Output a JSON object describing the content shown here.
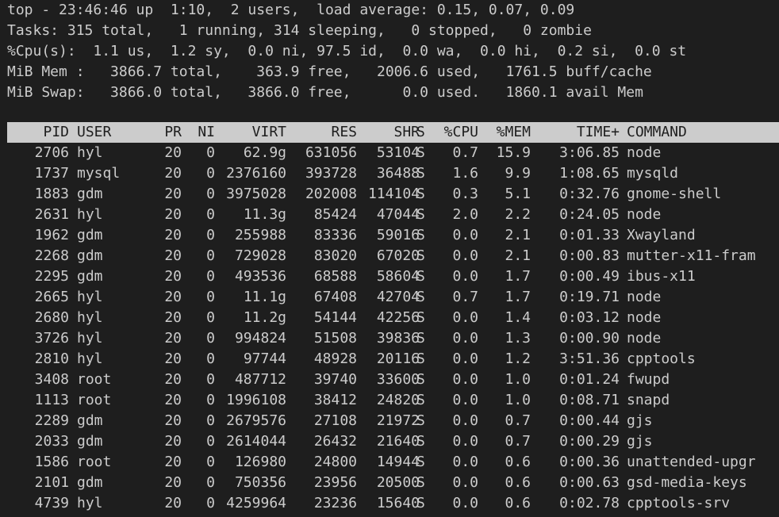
{
  "summary": {
    "line1": "top - 23:46:46 up  1:10,  2 users,  load average: 0.15, 0.07, 0.09",
    "line2": "Tasks: 315 total,   1 running, 314 sleeping,   0 stopped,   0 zombie",
    "line3": "%Cpu(s):  1.1 us,  1.2 sy,  0.0 ni, 97.5 id,  0.0 wa,  0.0 hi,  0.2 si,  0.0 st",
    "line4": "MiB Mem :   3866.7 total,    363.9 free,   2006.6 used,   1761.5 buff/cache",
    "line5": "MiB Swap:   3866.0 total,   3866.0 free,      0.0 used.   1860.1 avail Mem"
  },
  "columns": {
    "pid": "PID",
    "user": "USER",
    "pr": "PR",
    "ni": "NI",
    "virt": "VIRT",
    "res": "RES",
    "shr": "SHR",
    "s": "S",
    "cpu": "%CPU",
    "mem": "%MEM",
    "time": "TIME+",
    "command": "COMMAND"
  },
  "processes": [
    {
      "pid": "2706",
      "user": "hyl",
      "pr": "20",
      "ni": "0",
      "virt": "62.9g",
      "res": "631056",
      "shr": "53104",
      "s": "S",
      "cpu": "0.7",
      "mem": "15.9",
      "time": "3:06.85",
      "command": "node"
    },
    {
      "pid": "1737",
      "user": "mysql",
      "pr": "20",
      "ni": "0",
      "virt": "2376160",
      "res": "393728",
      "shr": "36488",
      "s": "S",
      "cpu": "1.6",
      "mem": "9.9",
      "time": "1:08.65",
      "command": "mysqld"
    },
    {
      "pid": "1883",
      "user": "gdm",
      "pr": "20",
      "ni": "0",
      "virt": "3975028",
      "res": "202008",
      "shr": "114104",
      "s": "S",
      "cpu": "0.3",
      "mem": "5.1",
      "time": "0:32.76",
      "command": "gnome-shell"
    },
    {
      "pid": "2631",
      "user": "hyl",
      "pr": "20",
      "ni": "0",
      "virt": "11.3g",
      "res": "85424",
      "shr": "47044",
      "s": "S",
      "cpu": "2.0",
      "mem": "2.2",
      "time": "0:24.05",
      "command": "node"
    },
    {
      "pid": "1962",
      "user": "gdm",
      "pr": "20",
      "ni": "0",
      "virt": "255988",
      "res": "83336",
      "shr": "59016",
      "s": "S",
      "cpu": "0.0",
      "mem": "2.1",
      "time": "0:01.33",
      "command": "Xwayland"
    },
    {
      "pid": "2268",
      "user": "gdm",
      "pr": "20",
      "ni": "0",
      "virt": "729028",
      "res": "83020",
      "shr": "67020",
      "s": "S",
      "cpu": "0.0",
      "mem": "2.1",
      "time": "0:00.83",
      "command": "mutter-x11-fram"
    },
    {
      "pid": "2295",
      "user": "gdm",
      "pr": "20",
      "ni": "0",
      "virt": "493536",
      "res": "68588",
      "shr": "58604",
      "s": "S",
      "cpu": "0.0",
      "mem": "1.7",
      "time": "0:00.49",
      "command": "ibus-x11"
    },
    {
      "pid": "2665",
      "user": "hyl",
      "pr": "20",
      "ni": "0",
      "virt": "11.1g",
      "res": "67408",
      "shr": "42704",
      "s": "S",
      "cpu": "0.7",
      "mem": "1.7",
      "time": "0:19.71",
      "command": "node"
    },
    {
      "pid": "2680",
      "user": "hyl",
      "pr": "20",
      "ni": "0",
      "virt": "11.2g",
      "res": "54144",
      "shr": "42256",
      "s": "S",
      "cpu": "0.0",
      "mem": "1.4",
      "time": "0:03.12",
      "command": "node"
    },
    {
      "pid": "3726",
      "user": "hyl",
      "pr": "20",
      "ni": "0",
      "virt": "994824",
      "res": "51508",
      "shr": "39836",
      "s": "S",
      "cpu": "0.0",
      "mem": "1.3",
      "time": "0:00.90",
      "command": "node"
    },
    {
      "pid": "2810",
      "user": "hyl",
      "pr": "20",
      "ni": "0",
      "virt": "97744",
      "res": "48928",
      "shr": "20116",
      "s": "S",
      "cpu": "0.0",
      "mem": "1.2",
      "time": "3:51.36",
      "command": "cpptools"
    },
    {
      "pid": "3408",
      "user": "root",
      "pr": "20",
      "ni": "0",
      "virt": "487712",
      "res": "39740",
      "shr": "33600",
      "s": "S",
      "cpu": "0.0",
      "mem": "1.0",
      "time": "0:01.24",
      "command": "fwupd"
    },
    {
      "pid": "1113",
      "user": "root",
      "pr": "20",
      "ni": "0",
      "virt": "1996108",
      "res": "38412",
      "shr": "24820",
      "s": "S",
      "cpu": "0.0",
      "mem": "1.0",
      "time": "0:08.71",
      "command": "snapd"
    },
    {
      "pid": "2289",
      "user": "gdm",
      "pr": "20",
      "ni": "0",
      "virt": "2679576",
      "res": "27108",
      "shr": "21972",
      "s": "S",
      "cpu": "0.0",
      "mem": "0.7",
      "time": "0:00.44",
      "command": "gjs"
    },
    {
      "pid": "2033",
      "user": "gdm",
      "pr": "20",
      "ni": "0",
      "virt": "2614044",
      "res": "26432",
      "shr": "21640",
      "s": "S",
      "cpu": "0.0",
      "mem": "0.7",
      "time": "0:00.29",
      "command": "gjs"
    },
    {
      "pid": "1586",
      "user": "root",
      "pr": "20",
      "ni": "0",
      "virt": "126980",
      "res": "24800",
      "shr": "14944",
      "s": "S",
      "cpu": "0.0",
      "mem": "0.6",
      "time": "0:00.36",
      "command": "unattended-upgr"
    },
    {
      "pid": "2101",
      "user": "gdm",
      "pr": "20",
      "ni": "0",
      "virt": "750356",
      "res": "23956",
      "shr": "20500",
      "s": "S",
      "cpu": "0.0",
      "mem": "0.6",
      "time": "0:00.63",
      "command": "gsd-media-keys"
    },
    {
      "pid": "4739",
      "user": "hyl",
      "pr": "20",
      "ni": "0",
      "virt": "4259964",
      "res": "23236",
      "shr": "15640",
      "s": "S",
      "cpu": "0.0",
      "mem": "0.6",
      "time": "0:02.78",
      "command": "cpptools-srv"
    }
  ],
  "colors": {
    "background": "#1e1e1e",
    "foreground": "#cccccc",
    "header_bar": "#cccccc",
    "header_text": "#1e1e1e"
  }
}
